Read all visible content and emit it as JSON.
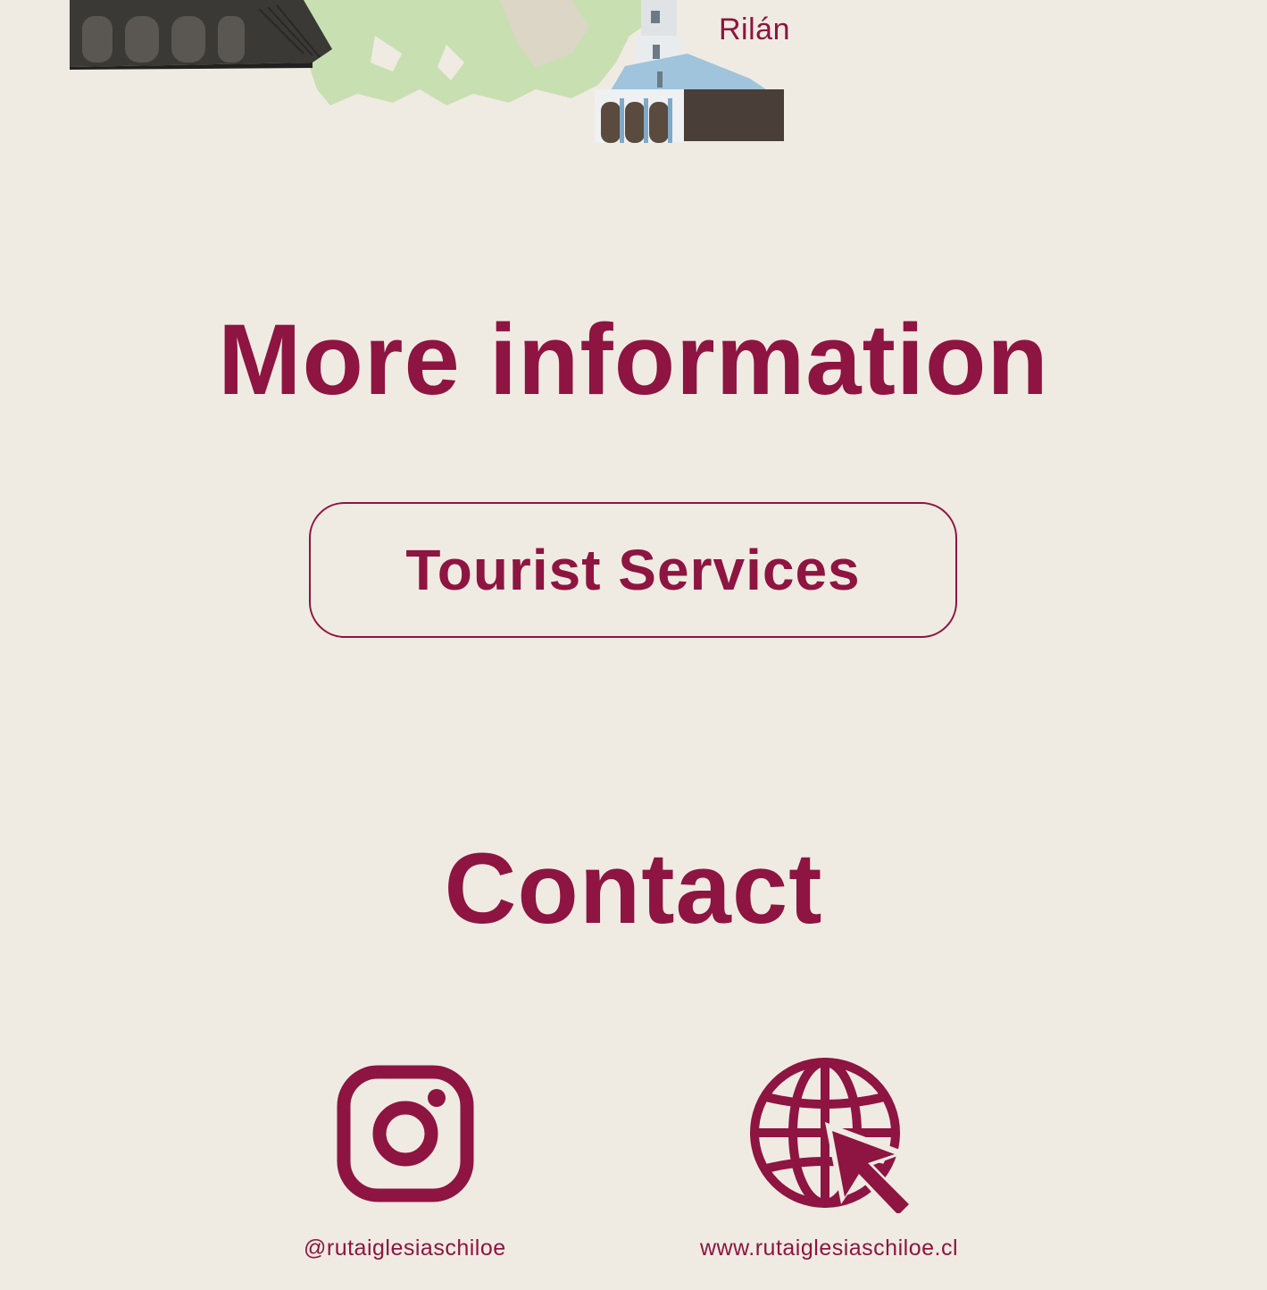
{
  "map": {
    "place_label": "Rilán"
  },
  "more_info": {
    "title": "More information",
    "button_label": "Tourist Services"
  },
  "contact": {
    "title": "Contact",
    "instagram_handle": "@rutaiglesiaschiloe",
    "website_url": "www.rutaiglesiaschiloe.cl",
    "icons": [
      "instagram-icon",
      "globe-cursor-icon"
    ]
  },
  "colors": {
    "accent": "#8e1441",
    "background": "#f0ebe2",
    "map_land": "#c8dfb2",
    "map_water": "#e6e1d6"
  }
}
